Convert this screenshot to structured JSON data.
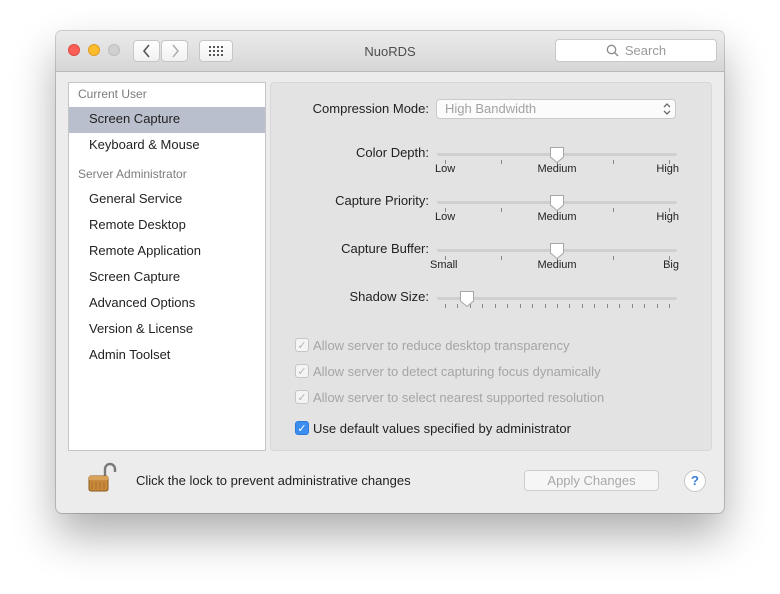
{
  "window": {
    "title": "NuoRDS"
  },
  "toolbar": {
    "back_icon": "chevron-left",
    "forward_icon": "chevron-right",
    "grid_icon": "show-all-grid"
  },
  "search": {
    "placeholder": "Search"
  },
  "sidebar": {
    "current_user_header": "Current User",
    "current_user_items": [
      {
        "label": "Screen Capture",
        "selected": true
      },
      {
        "label": "Keyboard & Mouse",
        "selected": false
      }
    ],
    "server_admin_header": "Server Administrator",
    "server_admin_items": [
      {
        "label": "General Service"
      },
      {
        "label": "Remote Desktop"
      },
      {
        "label": "Remote Application"
      },
      {
        "label": "Screen Capture"
      },
      {
        "label": "Advanced Options"
      },
      {
        "label": "Version & License"
      },
      {
        "label": "Admin Toolset"
      }
    ]
  },
  "settings": {
    "compression": {
      "label": "Compression Mode:",
      "value": "High Bandwidth"
    },
    "sliders": [
      {
        "label": "Color Depth:",
        "value": 0.5,
        "min_label": "Low",
        "mid_label": "Medium",
        "max_label": "High"
      },
      {
        "label": "Capture Priority:",
        "value": 0.5,
        "min_label": "Low",
        "mid_label": "Medium",
        "max_label": "High"
      },
      {
        "label": "Capture Buffer:",
        "value": 0.5,
        "min_label": "Small",
        "mid_label": "Medium",
        "max_label": "Big"
      },
      {
        "label": "Shadow Size:",
        "value": 0.1
      }
    ],
    "checkboxes": [
      {
        "label": "Allow server to reduce desktop transparency",
        "checked": true,
        "enabled": false
      },
      {
        "label": "Allow server to detect capturing focus dynamically",
        "checked": true,
        "enabled": false
      },
      {
        "label": "Allow server to select nearest supported resolution",
        "checked": true,
        "enabled": false
      },
      {
        "label": "Use default values specified by administrator",
        "checked": true,
        "enabled": true
      }
    ]
  },
  "footer": {
    "lock_icon": "unlocked-padlock",
    "lock_text": "Click the lock to prevent administrative changes",
    "apply_label": "Apply Changes",
    "help_label": "?"
  },
  "colors": {
    "accent": "#3b8ef0",
    "selection": "#b9bfcc",
    "disabled_text": "#a5a5a5"
  }
}
